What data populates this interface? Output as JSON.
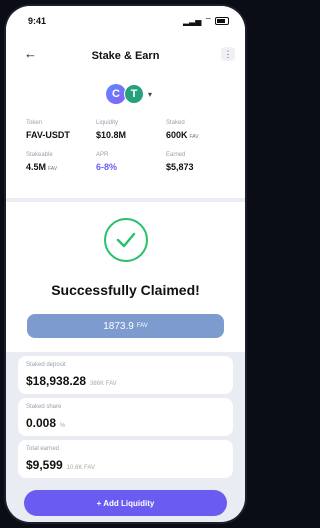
{
  "status": {
    "time": "9:41"
  },
  "header": {
    "title": "Stake & Earn",
    "back_icon": "arrow-left-icon",
    "menu_icon": "kebab-icon"
  },
  "pair": {
    "logo_left": "C",
    "logo_right": "T"
  },
  "info": {
    "token_label": "Token",
    "token_value": "FAV-USDT",
    "liquidity_label": "Liquidity",
    "liquidity_value": "$10.8M",
    "staked_label": "Staked",
    "staked_value": "600K",
    "staked_unit": "FAV",
    "stakeable_label": "Stakeable",
    "stakeable_value": "4.5M",
    "stakeable_unit": "FAV",
    "apr_label": "APR",
    "apr_value": "6-8%",
    "earned_label": "Earned",
    "earned_value": "$5,873"
  },
  "claim": {
    "title": "Successfully Claimed!",
    "amount": "1873.9",
    "unit": "FAV"
  },
  "stats": [
    {
      "label": "Staked deposit",
      "value": "$18,938.28",
      "sub": "386K FAV"
    },
    {
      "label": "Staked share",
      "value": "0.008",
      "sub": "%"
    },
    {
      "label": "Total earned",
      "value": "$9,599",
      "sub": "10.6K FAV"
    }
  ],
  "cta": {
    "label": "+ Add Liquidity"
  }
}
